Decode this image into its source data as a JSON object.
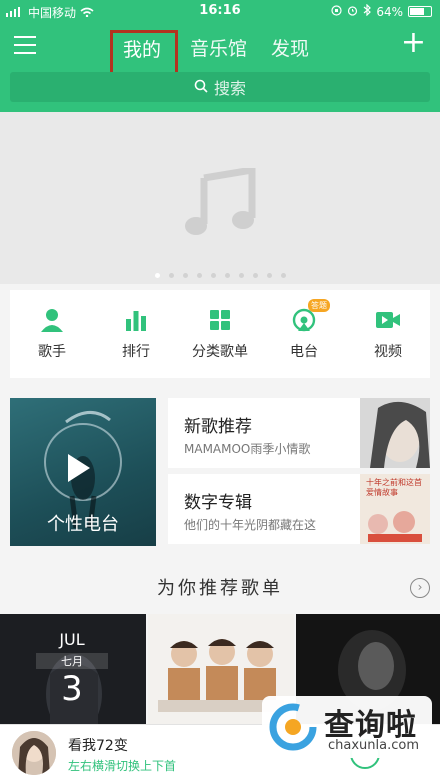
{
  "status_bar": {
    "carrier": "中国移动",
    "time": "16:16",
    "battery": "64%"
  },
  "header": {
    "tabs": [
      "我的",
      "音乐馆",
      "发现"
    ],
    "active_tab": "我的",
    "search_placeholder": "搜索"
  },
  "categories": [
    {
      "label": "歌手",
      "icon": "singer-icon"
    },
    {
      "label": "排行",
      "icon": "chart-bars-icon"
    },
    {
      "label": "分类歌单",
      "icon": "grid-icon"
    },
    {
      "label": "电台",
      "icon": "radio-icon",
      "badge": "答题"
    },
    {
      "label": "视频",
      "icon": "video-icon"
    }
  ],
  "features": {
    "radio_card": {
      "title": "个性电台"
    },
    "new_songs": {
      "title": "新歌推荐",
      "subtitle": "MAMAMOO雨季小情歌"
    },
    "album": {
      "title": "数字专辑",
      "subtitle": "他们的十年光阴都藏在这",
      "thumb_text": "十年之前和这首爱情故事"
    }
  },
  "section": {
    "title": "为你推荐歌单"
  },
  "playlists": [
    {
      "calendar_month": "JUL",
      "calendar_lunar": "七月",
      "calendar_day": "3"
    },
    {},
    {}
  ],
  "player": {
    "song": "看我72变",
    "hint": "左右横滑切换上下首"
  },
  "watermark": {
    "brand": "查询啦",
    "domain": "chaxunla.com"
  },
  "colors": {
    "accent": "#31c27c",
    "highlight_border": "#b3331f"
  }
}
